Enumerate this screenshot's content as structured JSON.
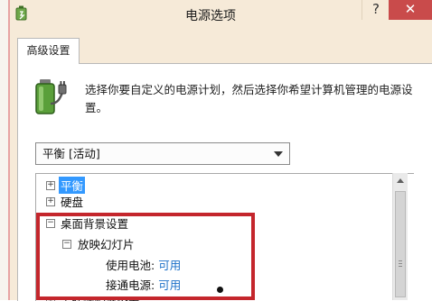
{
  "window": {
    "title": "电源选项",
    "help_label": "?",
    "close_label": "✕"
  },
  "tab": {
    "label": "高级设置"
  },
  "description": "选择你要自定义的电源计划，然后选择你希望计算机管理的电源设置。",
  "plan_select": {
    "value": "平衡 [活动]"
  },
  "tree": {
    "items": [
      {
        "expander": "+",
        "label": "平衡",
        "selected": true
      },
      {
        "expander": "+",
        "label": "硬盘"
      },
      {
        "expander": "−",
        "label": "桌面背景设置"
      },
      {
        "expander": "−",
        "label": "放映幻灯片"
      },
      {
        "label": "使用电池:",
        "value": "可用"
      },
      {
        "label": "接通电源:",
        "value": "可用"
      },
      {
        "expander": "+",
        "label": "无线适配器设置"
      }
    ]
  },
  "icons": {
    "app": "power-options-icon",
    "battery": "battery-plug-icon"
  },
  "colors": {
    "highlight_border": "#c4262c",
    "selection": "#3399ff",
    "value_link": "#1a6fc7",
    "close_button": "#c94b4b"
  }
}
